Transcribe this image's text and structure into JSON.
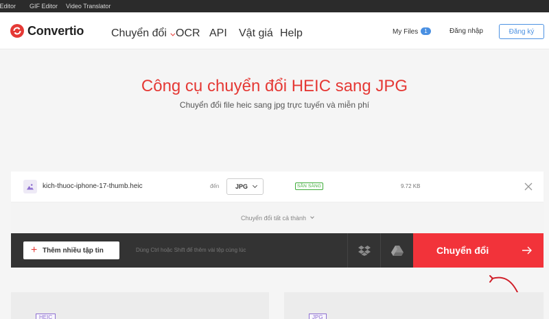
{
  "topbar": {
    "links": [
      "o Editor",
      "GIF Editor",
      "Video Translator"
    ]
  },
  "header": {
    "logo_text": "Convertio",
    "nav": {
      "convert": "Chuyển đổi",
      "ocr": "OCR",
      "api": "API",
      "pricing": "Vật giá",
      "help": "Help"
    },
    "my_files_label": "My Files",
    "my_files_count": "1",
    "login": "Đăng nhập",
    "signup": "Đăng ký"
  },
  "hero": {
    "title": "Công cụ chuyển đổi HEIC sang JPG",
    "subtitle": "Chuyển đổi file heic sang jpg trực tuyến và miễn phí"
  },
  "file_row": {
    "file_name": "kich-thuoc-iphone-17-thumb.heic",
    "to_label": "đến",
    "target_format": "JPG",
    "status": "SẴN SÀNG",
    "file_size": "9.72 KB"
  },
  "convert_all_label": "Chuyển đổi tất cả thành",
  "action_bar": {
    "add_more_label": "Thêm nhiều tập tin",
    "hint": "Dùng Ctrl hoặc Shift để thêm vài tệp cùng lúc",
    "convert_label": "Chuyển đổi"
  },
  "lower_cards": {
    "left_tag": "HEIC",
    "right_tag": "JPG"
  },
  "colors": {
    "brand_red": "#e53935",
    "convert_red": "#f2333a",
    "link_blue": "#4a90e2",
    "ready_green": "#3aaa35",
    "dark_bar": "#333333"
  }
}
